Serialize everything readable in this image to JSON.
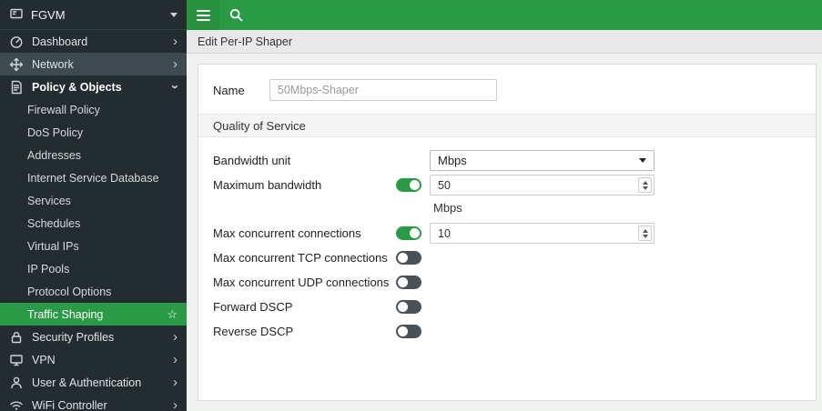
{
  "colors": {
    "accent_green": "#2b9a47",
    "sidebar_bg": "#232c30",
    "toggle_off": "#4a5257"
  },
  "sidebar": {
    "device_name": "FGVM",
    "items": [
      {
        "label": "Dashboard"
      },
      {
        "label": "Network"
      },
      {
        "label": "Policy & Objects"
      },
      {
        "label": "Security Profiles"
      },
      {
        "label": "VPN"
      },
      {
        "label": "User & Authentication"
      },
      {
        "label": "WiFi Controller"
      }
    ],
    "policy_objects_children": [
      {
        "label": "Firewall Policy"
      },
      {
        "label": "DoS Policy"
      },
      {
        "label": "Addresses"
      },
      {
        "label": "Internet Service Database"
      },
      {
        "label": "Services"
      },
      {
        "label": "Schedules"
      },
      {
        "label": "Virtual IPs"
      },
      {
        "label": "IP Pools"
      },
      {
        "label": "Protocol Options"
      },
      {
        "label": "Traffic Shaping"
      }
    ],
    "selected_item": "Traffic Shaping",
    "star_icon": "☆",
    "chevron": "›"
  },
  "breadcrumb": {
    "title": "Edit Per-IP Shaper"
  },
  "form": {
    "name": {
      "label": "Name",
      "placeholder": "50Mbps-Shaper"
    },
    "section_title": "Quality of Service",
    "bandwidth_unit": {
      "label": "Bandwidth unit",
      "value": "Mbps"
    },
    "maximum_bandwidth": {
      "label": "Maximum bandwidth",
      "enabled": "on",
      "value": "50",
      "unit": "Mbps"
    },
    "max_concurrent_connections": {
      "label": "Max concurrent connections",
      "enabled": "on",
      "value": "10"
    },
    "max_concurrent_tcp": {
      "label": "Max concurrent TCP connections",
      "enabled": "off"
    },
    "max_concurrent_udp": {
      "label": "Max concurrent UDP connections",
      "enabled": "off"
    },
    "forward_dscp": {
      "label": "Forward DSCP",
      "enabled": "off"
    },
    "reverse_dscp": {
      "label": "Reverse DSCP",
      "enabled": "off"
    }
  }
}
